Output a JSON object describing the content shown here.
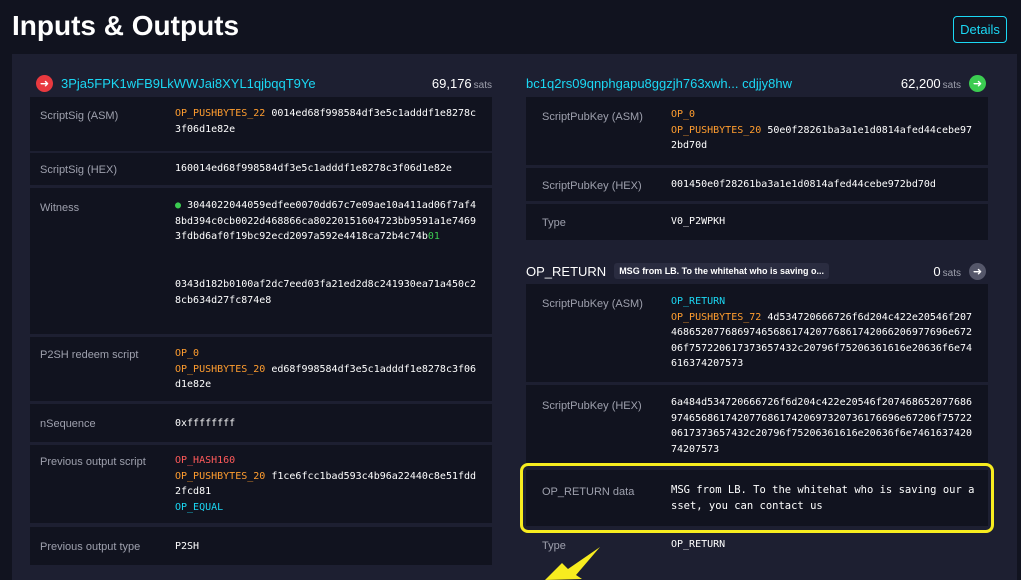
{
  "page": {
    "title": "Inputs & Outputs",
    "details_label": "Details"
  },
  "input": {
    "address": "3Pja5FPK1wFB9LkWWJai8XYL1qjbqqT9Ye",
    "amount": "69,176",
    "unit": "sats",
    "scriptsig_asm": {
      "label": "ScriptSig (ASM)",
      "op": "OP_PUSHBYTES_22",
      "value": "0014ed68f998584df3e5c1adddf1e8278c3f06d1e82e"
    },
    "scriptsig_hex": {
      "label": "ScriptSig (HEX)",
      "value": "160014ed68f998584df3e5c1adddf1e8278c3f06d1e82e"
    },
    "witness": {
      "label": "Witness",
      "value1a": "3044022044059edfee0070dd67c7e09ae10a411ad06f7af48bd394c0cb0022d468866ca80220151604723bb9591a1e74693fdbd6af0f19bc92ecd2097a592e4418ca72b4c74b",
      "value1b": "01",
      "value2": "0343d182b0100af2dc7eed03fa21ed2d8c241930ea71a450c28cb634d27fc874e8"
    },
    "p2sh_redeem": {
      "label": "P2SH redeem script",
      "op1": "OP_0",
      "op2": "OP_PUSHBYTES_20",
      "value": "ed68f998584df3e5c1adddf1e8278c3f06d1e82e"
    },
    "nsequence": {
      "label": "nSequence",
      "value": "0xffffffff"
    },
    "prev_output_script": {
      "label": "Previous output script",
      "op1": "OP_HASH160",
      "op2": "OP_PUSHBYTES_20",
      "value": "f1ce6fcc1bad593c4b96a22440c8e51fdd2fcd81",
      "op3": "OP_EQUAL"
    },
    "prev_output_type": {
      "label": "Previous output type",
      "value": "P2SH"
    }
  },
  "output1": {
    "address": "bc1q2rs09qnphgapu8ggzjh763xwh... cdjjy8hw",
    "amount": "62,200",
    "unit": "sats",
    "spk_asm": {
      "label": "ScriptPubKey (ASM)",
      "op1": "OP_0",
      "op2": "OP_PUSHBYTES_20",
      "value": "50e0f28261ba3a1e1d0814afed44cebe972bd70d"
    },
    "spk_hex": {
      "label": "ScriptPubKey (HEX)",
      "value": "001450e0f28261ba3a1e1d0814afed44cebe972bd70d"
    },
    "type": {
      "label": "Type",
      "value": "V0_P2WPKH"
    }
  },
  "output2": {
    "title": "OP_RETURN",
    "badge": "MSG from LB. To the whitehat who is saving o...",
    "amount": "0",
    "unit": "sats",
    "spk_asm": {
      "label": "ScriptPubKey (ASM)",
      "op1": "OP_RETURN",
      "op2": "OP_PUSHBYTES_72",
      "value": "4d534720666726f6d204c422e20546f2074686520776869746568617420776861742066206977696e67206f757220617373657432c20796f75206361616e20636f6e74616374207573"
    },
    "spk_hex": {
      "label": "ScriptPubKey (HEX)",
      "value": "6a484d534720666726f6d204c422e20546f20746865207768697465686174207768617420697320736176696e67206f757220617373657432c20796f75206361616e20636f6e746163742074207573"
    },
    "op_return_data": {
      "label": "OP_RETURN data",
      "value": "MSG from LB. To the whitehat who is saving our asset, you can contact us"
    },
    "type": {
      "label": "Type",
      "value": "OP_RETURN"
    }
  },
  "colors": {
    "accent": "#1bd8f4",
    "highlight": "#f7ec1f",
    "bg": "#11131f",
    "panel": "#1d1f31"
  }
}
